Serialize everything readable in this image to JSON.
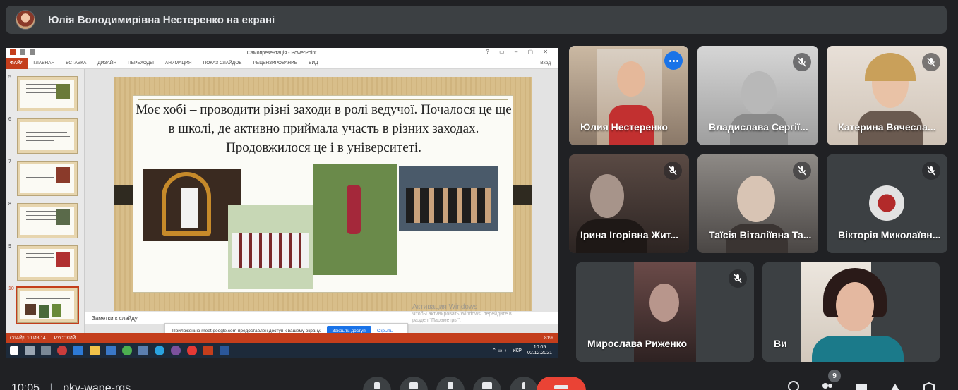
{
  "presenter_bar": {
    "text": "Юлія Володимирівна Нестеренко на екрані"
  },
  "powerpoint": {
    "window_title": "Самопрезентація - PowerPoint",
    "ribbon": {
      "file": "ФАЙЛ",
      "tabs": [
        "ГЛАВНАЯ",
        "ВСТАВКА",
        "ДИЗАЙН",
        "ПЕРЕХОДЫ",
        "АНИМАЦИЯ",
        "ПОКАЗ СЛАЙДОВ",
        "РЕЦЕНЗИРОВАНИЕ",
        "ВИД"
      ],
      "login": "Вход"
    },
    "thumbnails": [
      {
        "num": "5",
        "active": false
      },
      {
        "num": "6",
        "active": false
      },
      {
        "num": "7",
        "active": false
      },
      {
        "num": "8",
        "active": false
      },
      {
        "num": "9",
        "active": false
      },
      {
        "num": "10",
        "active": true
      }
    ],
    "slide_text": "Моє хобі – проводити різні заходи в ролі ведучої. Почалося це ще в школі, де активно приймала участь в різних заходах. Продовжилося це і в університеті.",
    "notes_placeholder": "Заметки к слайду",
    "notification": {
      "text": "Приложению meet.google.com предоставлен доступ к вашему экрану.",
      "grant": "Закрыть доступ",
      "hide": "Скрыть"
    },
    "watermark": {
      "title": "Активация Windows",
      "line1": "Чтобы активировать Windows, перейдите в",
      "line2": "раздел \"Параметры\"."
    },
    "status": {
      "slide": "СЛАЙД 10 ИЗ 14",
      "lang": "РУССКИЙ",
      "zoom": "81%"
    },
    "taskbar": {
      "lang": "УКР",
      "time": "10:05",
      "date": "02.12.2021"
    }
  },
  "participants": [
    {
      "name": "Юлия Нестеренко",
      "muted": false,
      "pinned": true
    },
    {
      "name": "Владислава Сергії...",
      "muted": true
    },
    {
      "name": "Катерина Вячесла...",
      "muted": true
    },
    {
      "name": "Ірина Ігорівна Жит...",
      "muted": true
    },
    {
      "name": "Таїсія Віталіївна Та...",
      "muted": true
    },
    {
      "name": "Вікторія Миколаївн...",
      "muted": true
    },
    {
      "name": "Мирослава Риженко",
      "muted": true
    },
    {
      "name": "Ви",
      "muted": false
    }
  ],
  "bottom_bar": {
    "time": "10:05",
    "meeting_code": "pkv-wape-rqs",
    "participant_count": "9"
  },
  "colors": {
    "accent": "#1a73e8",
    "ppt": "#c43e1c",
    "hangup": "#ea4335",
    "tile": "#3c4043",
    "bg": "#202124"
  }
}
